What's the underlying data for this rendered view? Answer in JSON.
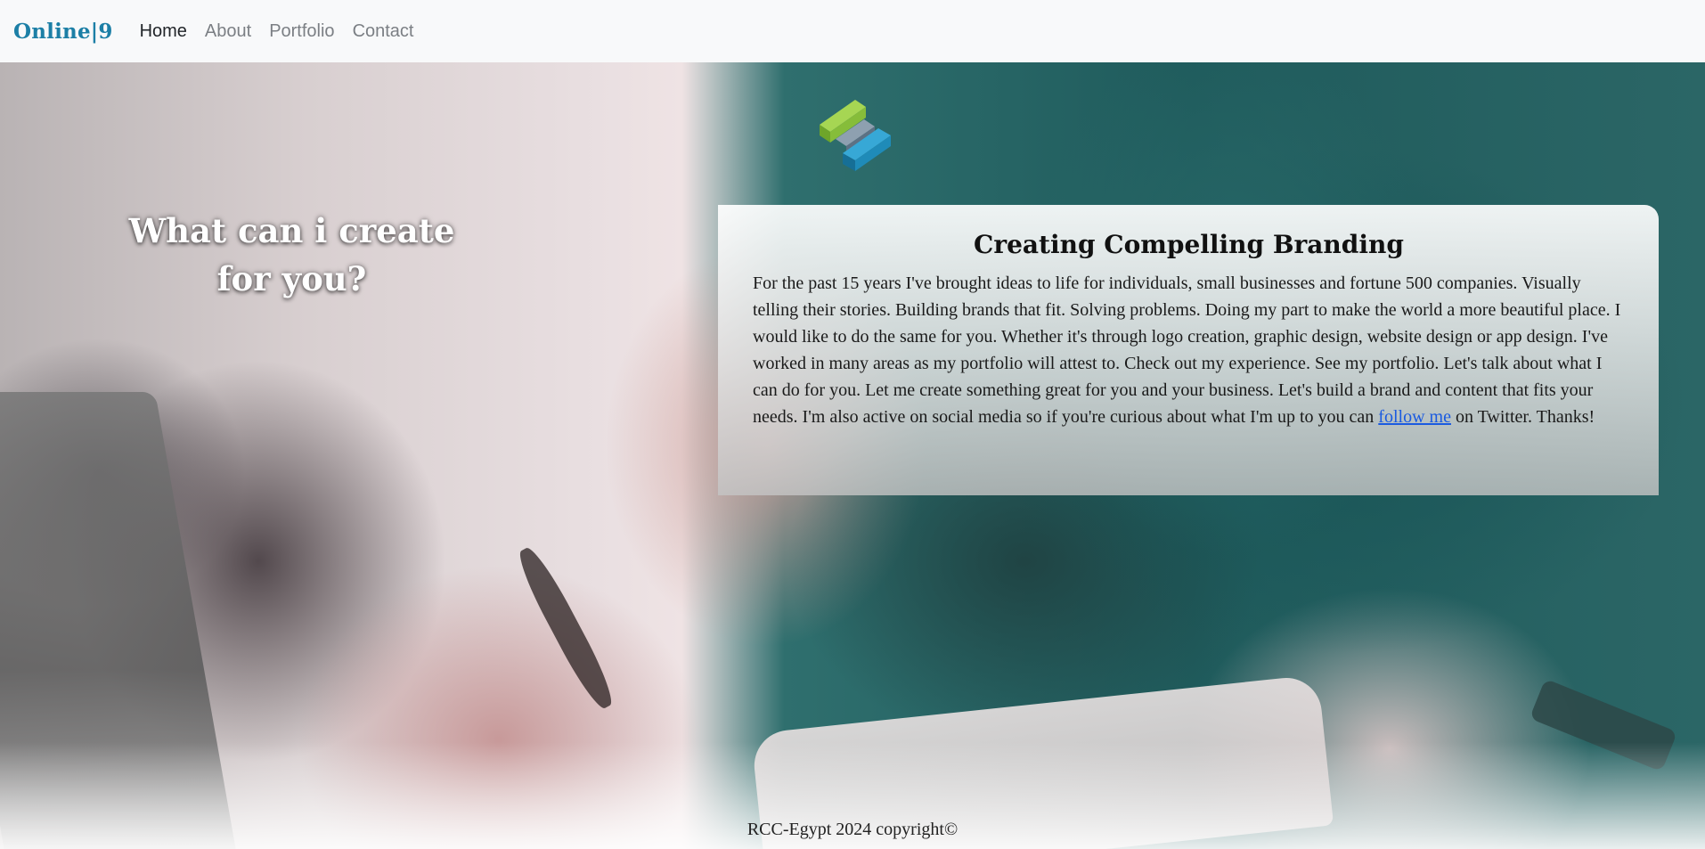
{
  "navbar": {
    "brand": "Online|9",
    "links": [
      {
        "label": "Home",
        "active": true
      },
      {
        "label": "About",
        "active": false
      },
      {
        "label": "Portfolio",
        "active": false
      },
      {
        "label": "Contact",
        "active": false
      }
    ]
  },
  "hero": {
    "headline": "What can i create for you?"
  },
  "card": {
    "title": "Creating Compelling Branding",
    "body_before_link": "For the past 15 years I've brought ideas to life for individuals, small businesses and fortune 500 companies. Visually telling their stories. Building brands that fit. Solving problems. Doing my part to make the world a more beautiful place. I would like to do the same for you. Whether it's through logo creation, graphic design, website design or app design. I've worked in many areas as my portfolio will attest to. Check out my experience. See my portfolio. Let's talk about what I can do for you. Let me create something great for you and your business. Let's build a brand and content that fits your needs. I'm also active on social media so if you're curious about what I'm up to you can ",
    "link_text": "follow me",
    "body_after_link": " on Twitter. Thanks!"
  },
  "footer": {
    "text": "RCC-Egypt 2024 copyright©"
  },
  "colors": {
    "brand": "#1c7fa6",
    "link": "#1a5ae0",
    "nav_inactive": "#7b7f84",
    "nav_active": "#212529"
  },
  "icons": {
    "logo": "layered-blocks-logo"
  }
}
